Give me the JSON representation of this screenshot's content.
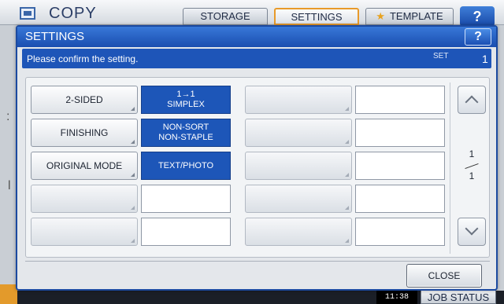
{
  "background": {
    "title": "COPY",
    "tabs": [
      {
        "label": "STORAGE"
      },
      {
        "label": "SETTINGS"
      },
      {
        "label": "TEMPLATE"
      }
    ],
    "help_label": "?",
    "clock": "11:38",
    "job_status_label": "JOB STATUS"
  },
  "dialog": {
    "title": "SETTINGS",
    "help_label": "?",
    "message": "Please confirm the setting.",
    "set_label": "SET",
    "set_number": "1",
    "rows": [
      {
        "label": "2-SIDED",
        "value_line1": "1→1",
        "value_line2": "SIMPLEX"
      },
      {
        "label": "FINISHING",
        "value_line1": "NON-SORT",
        "value_line2": "NON-STAPLE"
      },
      {
        "label": "ORIGINAL MODE",
        "value_line1": "TEXT/PHOTO",
        "value_line2": ""
      }
    ],
    "page": {
      "current": "1",
      "total": "1"
    },
    "close_label": "CLOSE"
  },
  "colors": {
    "header_blue": "#1a4eb0",
    "value_blue": "#1d56b8",
    "active_tab_border": "#e89a2a"
  },
  "icons": [
    "copy-icon",
    "star-icon",
    "scroll-up-icon",
    "scroll-down-icon"
  ]
}
